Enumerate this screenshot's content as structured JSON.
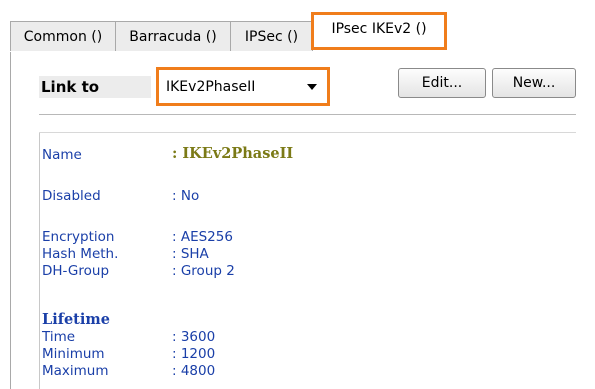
{
  "tabs": [
    {
      "label": "Common ()"
    },
    {
      "label": "Barracuda ()"
    },
    {
      "label": "IPSec ()"
    },
    {
      "label": "IPsec IKEv2 ()"
    }
  ],
  "link_to": {
    "label": "Link to",
    "selected": "IKEv2PhaseII"
  },
  "buttons": {
    "edit": "Edit...",
    "new": "New..."
  },
  "properties": {
    "name": {
      "key": "Name",
      "value": ": IKEv2PhaseII"
    },
    "disabled": {
      "key": "Disabled",
      "value": ": No"
    },
    "encryption": {
      "key": "Encryption",
      "value": ": AES256"
    },
    "hash": {
      "key": "Hash Meth.",
      "value": ": SHA"
    },
    "dh_group": {
      "key": "DH-Group",
      "value": ": Group 2"
    }
  },
  "lifetime": {
    "heading": "Lifetime",
    "time": {
      "key": "Time",
      "value": ": 3600"
    },
    "minimum": {
      "key": "Minimum",
      "value": ": 1200"
    },
    "maximum": {
      "key": "Maximum",
      "value": ": 4800"
    }
  },
  "colors": {
    "highlight": "#f07d1b",
    "label_blue": "#1a3fa8",
    "name_olive": "#7b7a16"
  }
}
